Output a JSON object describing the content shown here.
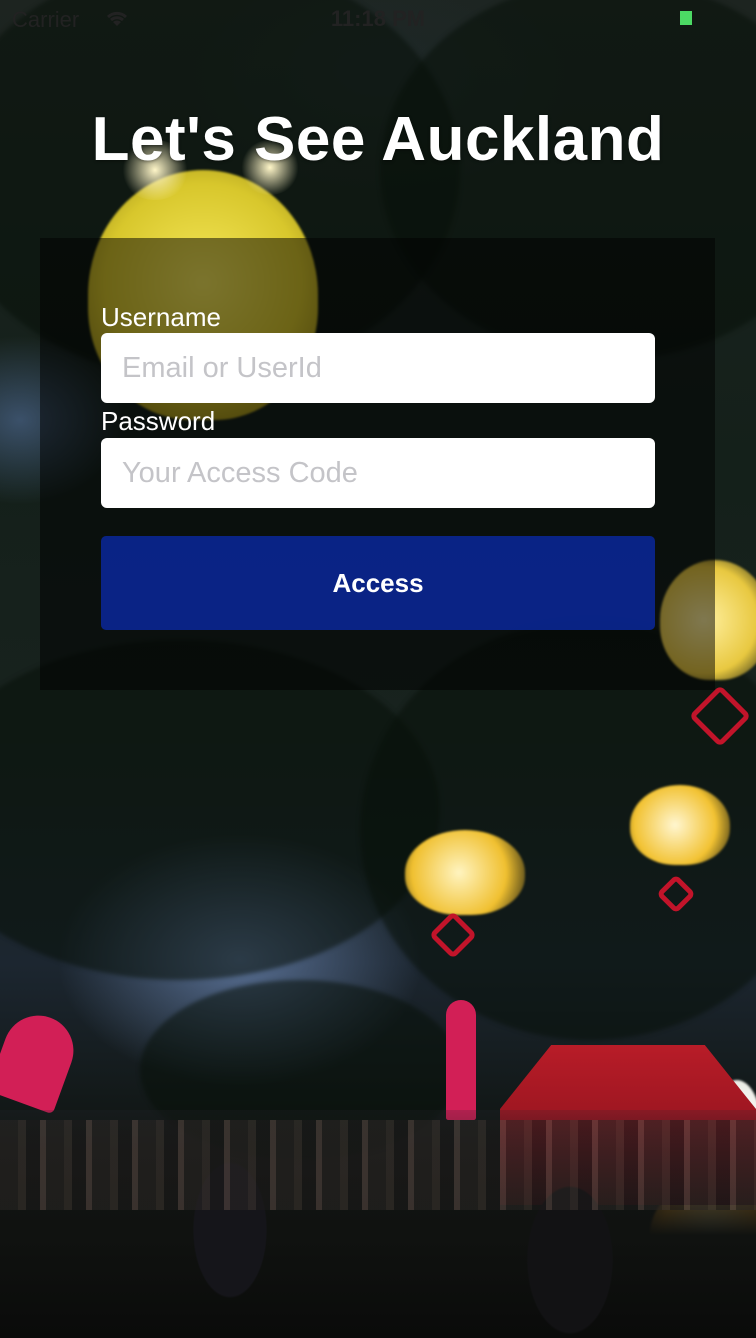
{
  "status_bar": {
    "carrier": "Carrier",
    "time": "11:18 PM",
    "wifi_icon": "wifi-icon",
    "battery_icon": "battery-icon"
  },
  "title": "Let's See Auckland",
  "login": {
    "username_label": "Username",
    "username_placeholder": "Email or UserId",
    "username_value": "",
    "password_label": "Password",
    "password_placeholder": "Your Access Code",
    "password_value": "",
    "access_button_label": "Access"
  },
  "colors": {
    "button_blue": "#0a28a0",
    "panel_overlay": "rgba(0,0,0,0.5)",
    "battery_green": "#4cd964",
    "title_text": "#ffffff"
  }
}
